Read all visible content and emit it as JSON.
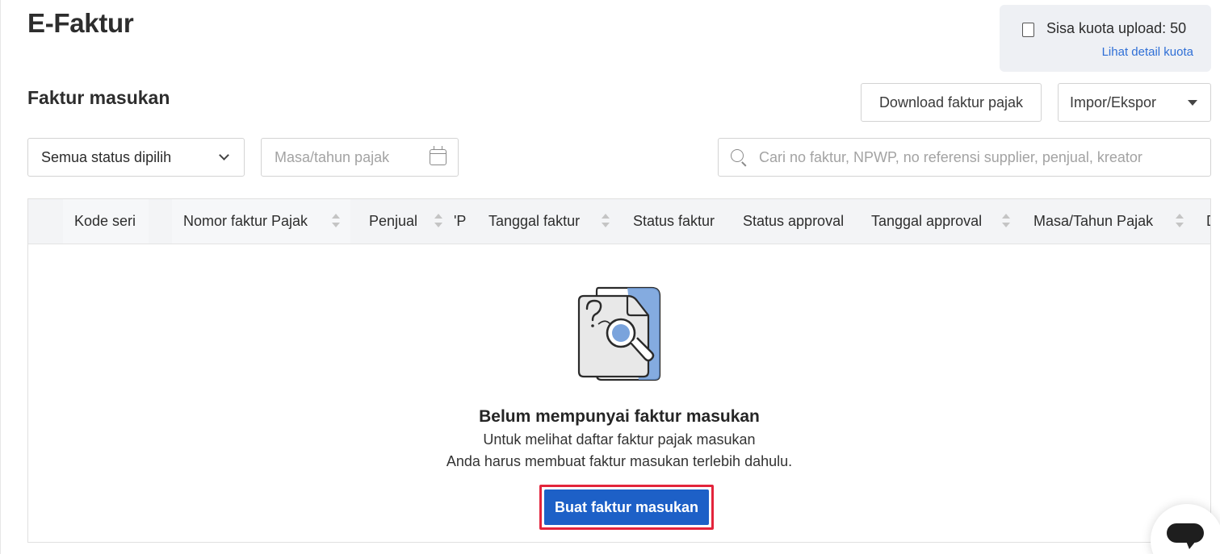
{
  "page": {
    "title": "E-Faktur"
  },
  "quota": {
    "label": "Sisa kuota upload: 50",
    "link": "Lihat detail kuota"
  },
  "section": {
    "title": "Faktur masukan"
  },
  "actions": {
    "download_label": "Download faktur pajak",
    "impor_label": "Impor/Ekspor"
  },
  "filters": {
    "status_value": "Semua status dipilih",
    "period_placeholder": "Masa/tahun pajak",
    "search_placeholder": "Cari no faktur, NPWP, no referensi supplier, penjual, kreator"
  },
  "table": {
    "columns": [
      {
        "label": "Kode seri",
        "sortable": false
      },
      {
        "label": "Nomor faktur Pajak",
        "sortable": true
      },
      {
        "label": "Penjual",
        "sortable": true
      },
      {
        "label": "'P",
        "sortable": false
      },
      {
        "label": "Tanggal faktur",
        "sortable": true
      },
      {
        "label": "Status faktur",
        "sortable": false
      },
      {
        "label": "Status approval",
        "sortable": false
      },
      {
        "label": "Tanggal approval",
        "sortable": true
      },
      {
        "label": "Masa/Tahun Pajak",
        "sortable": true
      },
      {
        "label": "D",
        "sortable": false
      }
    ]
  },
  "empty_state": {
    "illustration_icon": "document-search-icon",
    "title": "Belum mempunyai faktur masukan",
    "line1": "Untuk melihat daftar faktur pajak masukan",
    "line2": "Anda harus membuat faktur masukan terlebih dahulu.",
    "cta": "Buat faktur masukan"
  },
  "colors": {
    "primary": "#1d60c7",
    "link": "#2f6fd6",
    "highlight": "#e3243b"
  }
}
